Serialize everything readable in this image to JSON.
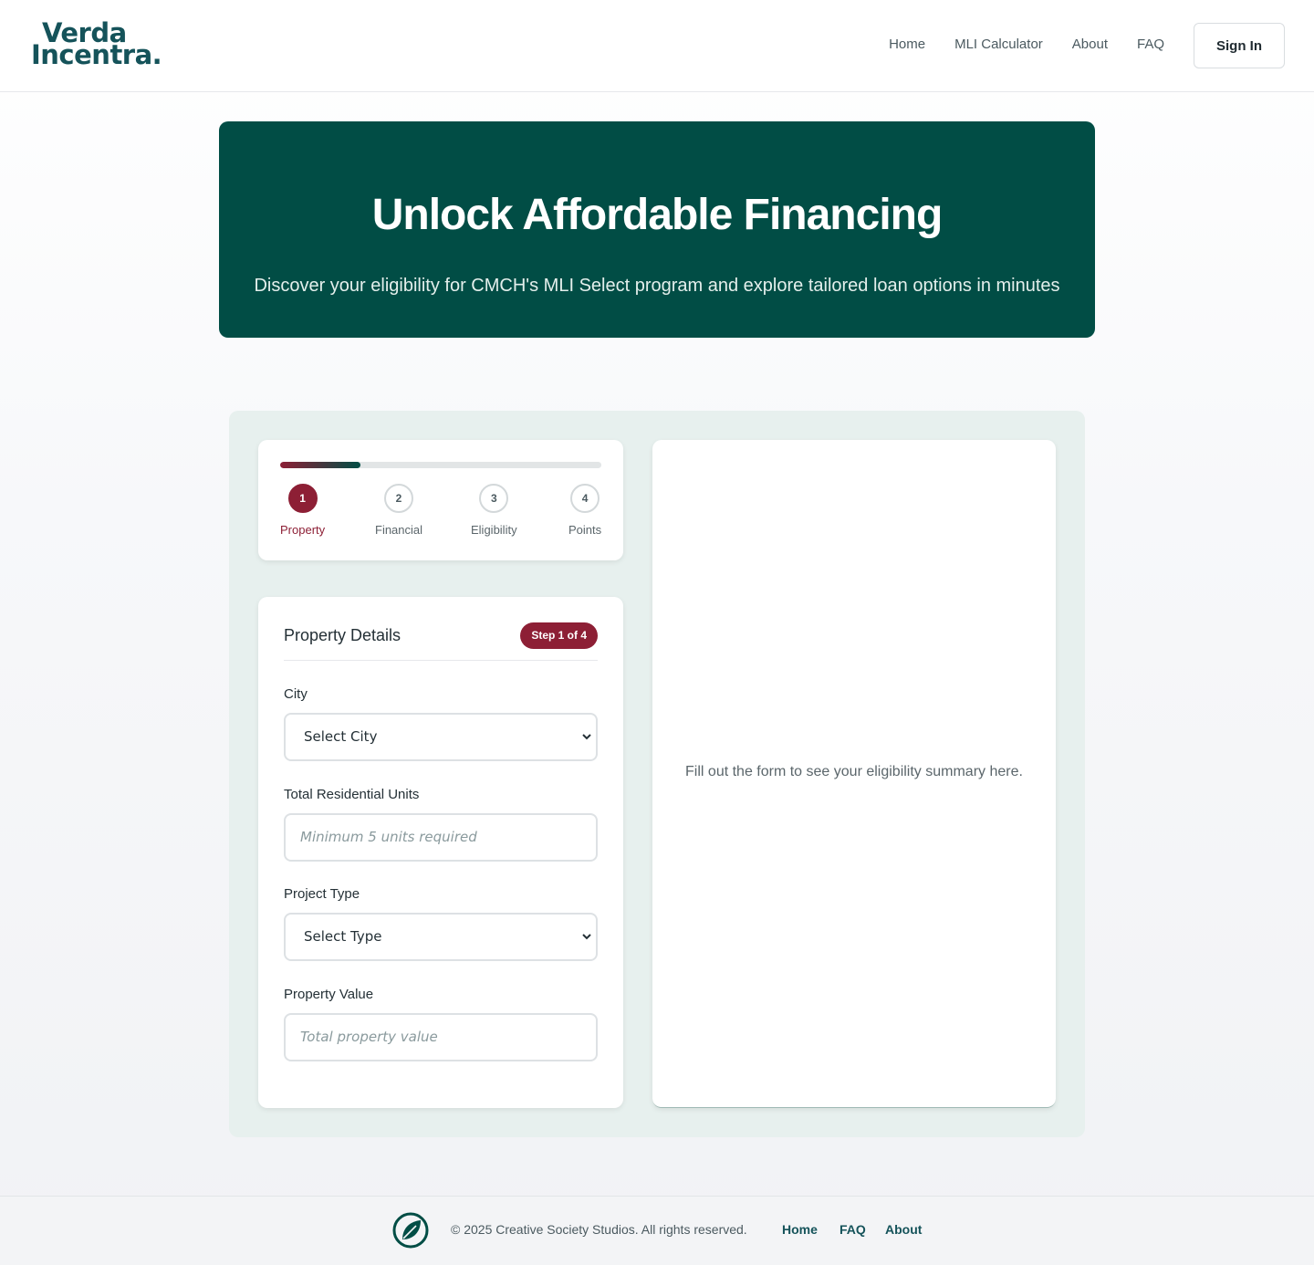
{
  "header": {
    "logo_line1": "Verda",
    "logo_line2": "Incentra.",
    "nav": [
      "Home",
      "MLI Calculator",
      "About",
      "FAQ"
    ],
    "signin_label": "Sign In"
  },
  "hero": {
    "title": "Unlock Affordable Financing",
    "subtitle": "Discover your eligibility for CMCH's MLI Select program and explore tailored loan options in minutes"
  },
  "stepper": {
    "progress_percent": 25,
    "steps": [
      {
        "number": "1",
        "label": "Property"
      },
      {
        "number": "2",
        "label": "Financial"
      },
      {
        "number": "3",
        "label": "Eligibility"
      },
      {
        "number": "4",
        "label": "Points"
      }
    ],
    "active_step": 1
  },
  "form": {
    "title": "Property Details",
    "badge": "Step 1 of 4",
    "city": {
      "label": "City",
      "value": "Select City"
    },
    "units": {
      "label": "Total Residential Units",
      "placeholder": "Minimum 5 units required"
    },
    "project_type": {
      "label": "Project Type",
      "value": "Select Type"
    },
    "property_value": {
      "label": "Property Value",
      "placeholder": "Total property value"
    }
  },
  "summary": {
    "empty_text": "Fill out the form to see your eligibility summary here."
  },
  "footer": {
    "copyright": "© 2025 Creative Society Studios. All rights reserved.",
    "links": [
      "Home",
      "FAQ",
      "About"
    ]
  },
  "colors": {
    "brand_green": "#014d45",
    "accent_maroon": "#8d1f35",
    "panel_bg": "#e7f0ee"
  }
}
